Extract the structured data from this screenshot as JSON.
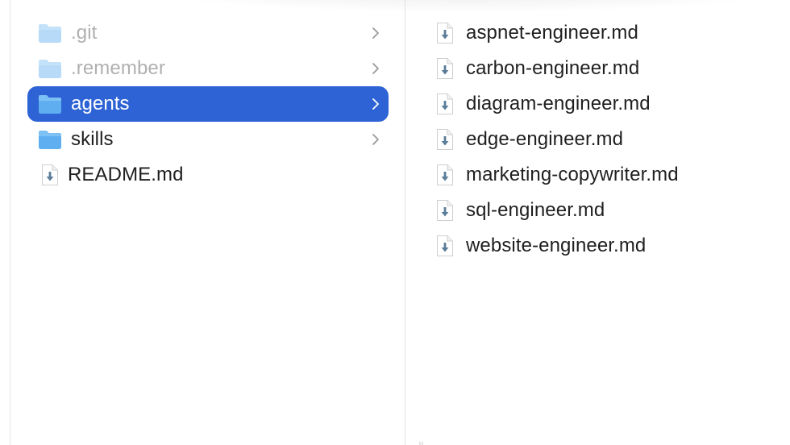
{
  "icons": {
    "folder": "folder-icon",
    "markdown": "markdown-document-icon",
    "chevron": "chevron-right-icon"
  },
  "colors": {
    "selection": "#2e63d5",
    "folder_body": "#5eaef0",
    "folder_tab": "#7cc0f5",
    "text": "#1f1f1f",
    "dimmed_text": "#b0b0b0"
  },
  "column1": {
    "items": [
      {
        "label": ".git",
        "kind": "folder",
        "hidden": true,
        "selected": false,
        "has_children": true
      },
      {
        "label": ".remember",
        "kind": "folder",
        "hidden": true,
        "selected": false,
        "has_children": true
      },
      {
        "label": "agents",
        "kind": "folder",
        "hidden": false,
        "selected": true,
        "has_children": true
      },
      {
        "label": "skills",
        "kind": "folder",
        "hidden": false,
        "selected": false,
        "has_children": true
      },
      {
        "label": "README.md",
        "kind": "markdown",
        "hidden": false,
        "selected": false,
        "has_children": false
      }
    ]
  },
  "column2": {
    "items": [
      {
        "label": "aspnet-engineer.md",
        "kind": "markdown"
      },
      {
        "label": "carbon-engineer.md",
        "kind": "markdown"
      },
      {
        "label": "diagram-engineer.md",
        "kind": "markdown"
      },
      {
        "label": "edge-engineer.md",
        "kind": "markdown"
      },
      {
        "label": "marketing-copywriter.md",
        "kind": "markdown"
      },
      {
        "label": "sql-engineer.md",
        "kind": "markdown"
      },
      {
        "label": "website-engineer.md",
        "kind": "markdown"
      }
    ]
  }
}
